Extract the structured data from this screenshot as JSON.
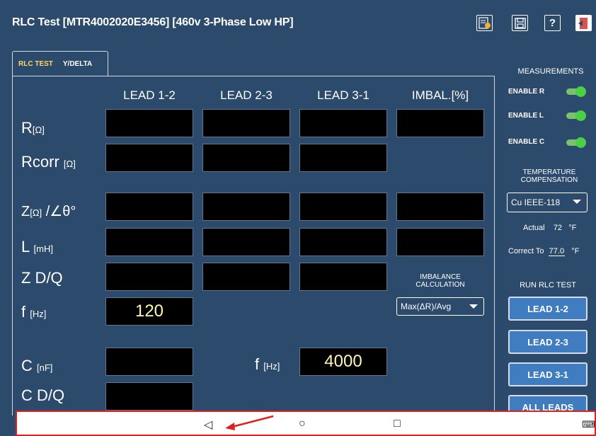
{
  "window": {
    "title": "RLC Test  [MTR4002020E3456] [460v 3-Phase Low HP]"
  },
  "toolbar": {
    "icons": [
      "settings-doc-icon",
      "save-icon",
      "help-icon",
      "exit-icon"
    ],
    "help_label": "?"
  },
  "tabs": {
    "rlc_test": "RLC TEST",
    "y_delta": "Y/DELTA"
  },
  "grid": {
    "columns": [
      "LEAD 1-2",
      "LEAD 2-3",
      "LEAD 3-1",
      "IMBAL.[%]"
    ],
    "rows": {
      "r": {
        "label": "R",
        "unit": "[Ω]"
      },
      "rcorr": {
        "label": "Rcorr",
        "unit": "[Ω]"
      },
      "z": {
        "label": "Z",
        "unit": "[Ω]",
        "suffix": " /∠θ°"
      },
      "l": {
        "label": "L",
        "unit": "[mH]"
      },
      "zdq": {
        "label": "Z D/Q"
      },
      "f": {
        "label": "f",
        "unit": "[Hz]",
        "value": "120"
      },
      "c": {
        "label": "C",
        "unit": "[nF]"
      },
      "cdq": {
        "label": "C D/Q"
      }
    },
    "c_freq": {
      "label": "f",
      "unit": "[Hz]",
      "value": "4000"
    }
  },
  "imbalance": {
    "label": "IMBALANCE CALCULATION",
    "selected": "Max(ΔR)/Avg"
  },
  "measurements": {
    "title": "MEASUREMENTS",
    "enable_r": "ENABLE R",
    "enable_l": "ENABLE L",
    "enable_c": "ENABLE C",
    "states": {
      "r": true,
      "l": true,
      "c": true
    }
  },
  "temperature": {
    "title": "TEMPERATURE COMPENSATION",
    "selected": "Cu IEEE-118",
    "actual_label": "Actual",
    "actual_value": "72",
    "correct_label": "Correct To",
    "correct_value": "77.0",
    "unit": "°F"
  },
  "run": {
    "title": "RUN RLC TEST",
    "buttons": [
      "LEAD 1-2",
      "LEAD 2-3",
      "LEAD 3-1",
      "ALL LEADS"
    ]
  },
  "navbar": {
    "back": "◁",
    "home": "○",
    "recents": "□",
    "keyboard": "⌨"
  },
  "colors": {
    "background": "#2c4a6b",
    "button": "#3f7cc0",
    "toggle_on": "#49d045",
    "value_text": "#fff7b0",
    "tab_active": "#ffd966",
    "annotation": "#e02020"
  }
}
